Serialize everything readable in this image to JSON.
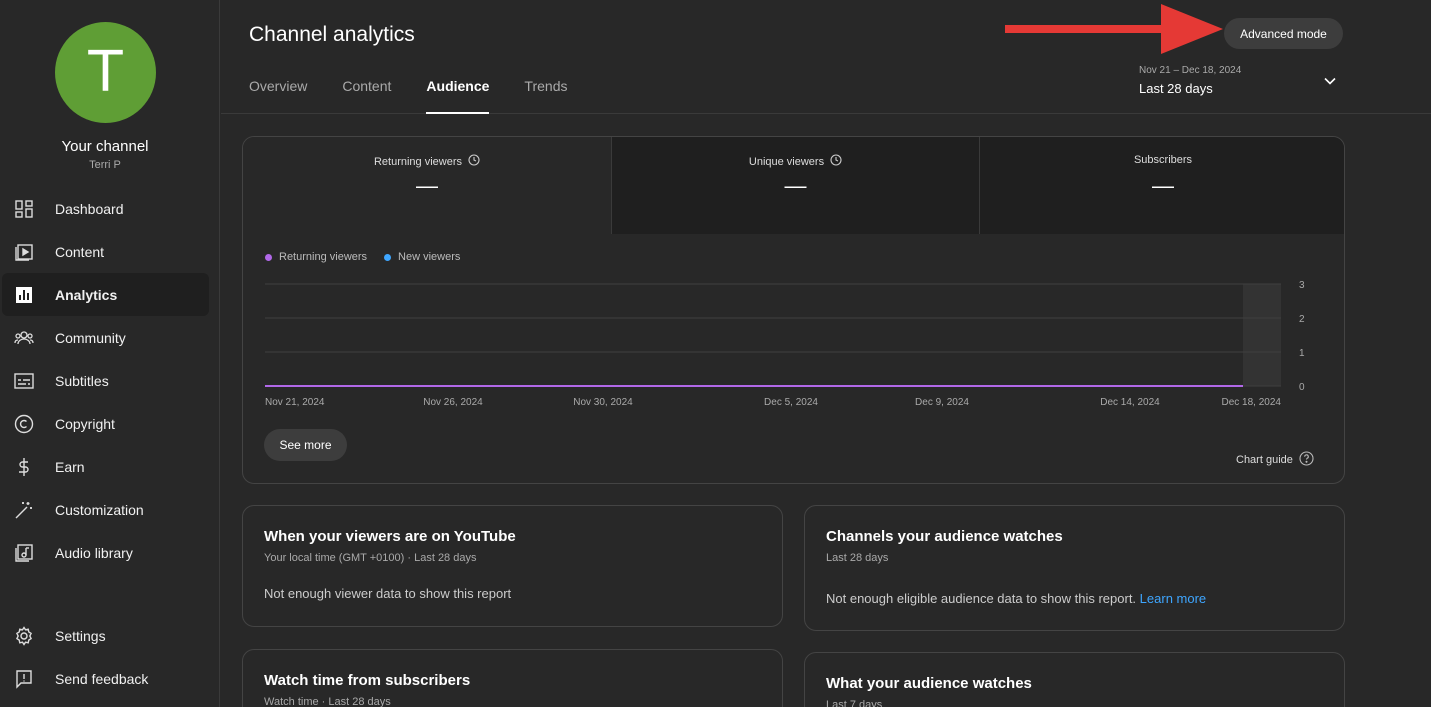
{
  "sidebar": {
    "avatar_letter": "T",
    "channel_name": "Your channel",
    "channel_owner": "Terri P",
    "items": [
      {
        "label": "Dashboard",
        "icon": "dashboard-icon"
      },
      {
        "label": "Content",
        "icon": "content-icon"
      },
      {
        "label": "Analytics",
        "icon": "analytics-icon"
      },
      {
        "label": "Community",
        "icon": "community-icon"
      },
      {
        "label": "Subtitles",
        "icon": "subtitles-icon"
      },
      {
        "label": "Copyright",
        "icon": "copyright-icon"
      },
      {
        "label": "Earn",
        "icon": "earn-icon"
      },
      {
        "label": "Customization",
        "icon": "customization-icon"
      },
      {
        "label": "Audio library",
        "icon": "audio-library-icon"
      }
    ],
    "bottom_items": [
      {
        "label": "Settings",
        "icon": "settings-icon"
      },
      {
        "label": "Send feedback",
        "icon": "feedback-icon"
      }
    ],
    "active_item": "Analytics"
  },
  "header": {
    "title": "Channel analytics",
    "tabs": [
      "Overview",
      "Content",
      "Audience",
      "Trends"
    ],
    "active_tab": "Audience",
    "advanced_mode_label": "Advanced mode",
    "date_range": "Nov 21 – Dec 18, 2024",
    "date_label": "Last 28 days"
  },
  "metrics": [
    {
      "label": "Returning viewers",
      "value": "—",
      "info_icon": true
    },
    {
      "label": "Unique viewers",
      "value": "—",
      "info_icon": true
    },
    {
      "label": "Subscribers",
      "value": "—",
      "info_icon": false
    }
  ],
  "legend": [
    {
      "name": "Returning viewers",
      "color": "#b168e8"
    },
    {
      "name": "New viewers",
      "color": "#3ea6ff"
    }
  ],
  "see_more_label": "See more",
  "chart_guide_label": "Chart guide",
  "chart_data": {
    "type": "line",
    "x_tick_labels": [
      "Nov 21, 2024",
      "Nov 26, 2024",
      "Nov 30, 2024",
      "Dec 5, 2024",
      "Dec 9, 2024",
      "Dec 14, 2024",
      "Dec 18, 2024"
    ],
    "ylim": [
      0,
      3
    ],
    "y_ticks": [
      0,
      1,
      2,
      3
    ],
    "series": [
      {
        "name": "Returning viewers",
        "color": "#b168e8",
        "values": [
          0,
          0,
          0,
          0,
          0,
          0,
          0
        ]
      },
      {
        "name": "New viewers",
        "color": "#3ea6ff",
        "values": [
          0,
          0,
          0,
          0,
          0,
          0,
          0
        ]
      }
    ],
    "grid": true
  },
  "reports": {
    "when": {
      "title": "When your viewers are on YouTube",
      "subtitle": "Your local time (GMT +0100) · Last 28 days",
      "message": "Not enough viewer data to show this report"
    },
    "channels": {
      "title": "Channels your audience watches",
      "subtitle": "Last 28 days",
      "message": "Not enough eligible audience data to show this report.",
      "link": "Learn more"
    },
    "watch_time": {
      "title": "Watch time from subscribers",
      "subtitle": "Watch time · Last 28 days"
    },
    "what_watch": {
      "title": "What your audience watches",
      "subtitle": "Last 7 days"
    }
  },
  "colors": {
    "background": "#282828",
    "accent_red_arrow": "#e53935",
    "avatar_green": "#5f9e35",
    "link_blue": "#3ea6ff"
  }
}
